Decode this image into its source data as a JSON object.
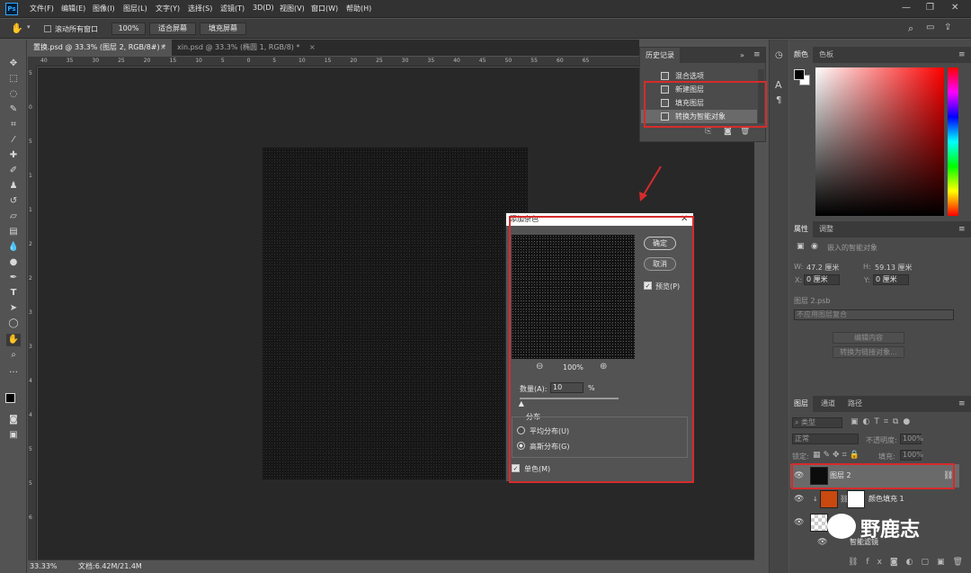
{
  "app": {
    "logo": "Ps"
  },
  "menu": [
    "文件(F)",
    "编辑(E)",
    "图像(I)",
    "图层(L)",
    "文字(Y)",
    "选择(S)",
    "滤镜(T)",
    "3D(D)",
    "视图(V)",
    "窗口(W)",
    "帮助(H)"
  ],
  "options": {
    "scroll_all": "滚动所有窗口",
    "zoom": "100%",
    "fit": "适合屏幕",
    "fill": "填充屏幕"
  },
  "tabs": [
    {
      "label": "置换.psd @ 33.3% (图层 2, RGB/8#) *",
      "close": "×"
    },
    {
      "label": "xin.psd @ 33.3% (椭圆 1, RGB/8) *",
      "close": "×"
    }
  ],
  "ruler_h": [
    "40",
    "35",
    "30",
    "25",
    "20",
    "15",
    "10",
    "5",
    "0",
    "5",
    "10",
    "15",
    "20",
    "25",
    "30",
    "35",
    "40",
    "45",
    "50",
    "55",
    "60",
    "65"
  ],
  "ruler_v": [
    "5",
    "0",
    "5",
    "1",
    "1",
    "2",
    "2",
    "3",
    "3",
    "4",
    "4",
    "5",
    "5",
    "6"
  ],
  "status": {
    "zoom": "33.33%",
    "doc": "文档:6.42M/21.4M"
  },
  "history": {
    "title": "历史记录",
    "items": [
      "混合选项",
      "新建图层",
      "填充图层",
      "转换为智能对象"
    ]
  },
  "color_panel": {
    "tabs": [
      "颜色",
      "色板"
    ]
  },
  "properties": {
    "tabs": [
      "属性",
      "调整"
    ],
    "type": "嵌入的智能对象",
    "w_label": "W:",
    "w_value": "47.2 厘米",
    "h_label": "H:",
    "h_value": "59.13 厘米",
    "x_label": "X:",
    "x_value": "0 厘米",
    "y_label": "Y:",
    "y_value": "0 厘米",
    "source": "图层 2.psb",
    "comp": "不应用图层复合",
    "edit": "编辑内容",
    "convert": "转换为链接对象..."
  },
  "layers": {
    "tabs": [
      "图层",
      "通道",
      "路径"
    ],
    "filter": "类型",
    "mode": "正常",
    "opacity_label": "不透明度:",
    "opacity": "100%",
    "lock_label": "锁定:",
    "fill_label": "填充:",
    "fill": "100%",
    "items": [
      {
        "name": "图层 2"
      },
      {
        "name": "颜色填充 1"
      },
      {
        "name": "智能滤镜"
      }
    ],
    "watermark": "野鹿志"
  },
  "dialog": {
    "title": "添加杂色",
    "ok": "确定",
    "cancel": "取消",
    "preview": "预览(P)",
    "zoom": "100%",
    "amount_label": "数量(A):",
    "amount": "10",
    "pct": "%",
    "dist_label": "分布",
    "uniform": "平均分布(U)",
    "gaussian": "高斯分布(G)",
    "mono": "单色(M)"
  }
}
